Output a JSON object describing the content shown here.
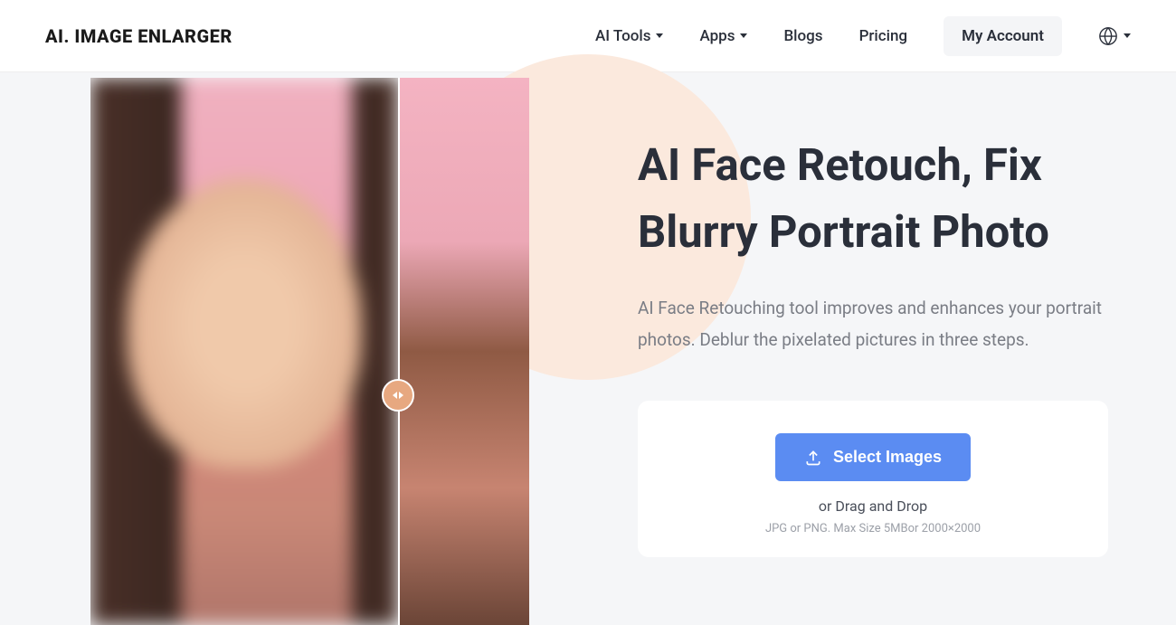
{
  "header": {
    "logo": "AI. IMAGE ENLARGER",
    "nav": {
      "ai_tools": "AI Tools",
      "apps": "Apps",
      "blogs": "Blogs",
      "pricing": "Pricing",
      "account": "My Account"
    }
  },
  "hero": {
    "title": "AI Face Retouch, Fix Blurry Portrait Photo",
    "description": "AI Face Retouching tool improves and enhances your portrait photos. Deblur the pixelated pictures in three steps."
  },
  "upload": {
    "button_label": "Select Images",
    "drag_text": "or Drag and Drop",
    "format_text": "JPG or PNG. Max Size 5MBor 2000×2000"
  }
}
